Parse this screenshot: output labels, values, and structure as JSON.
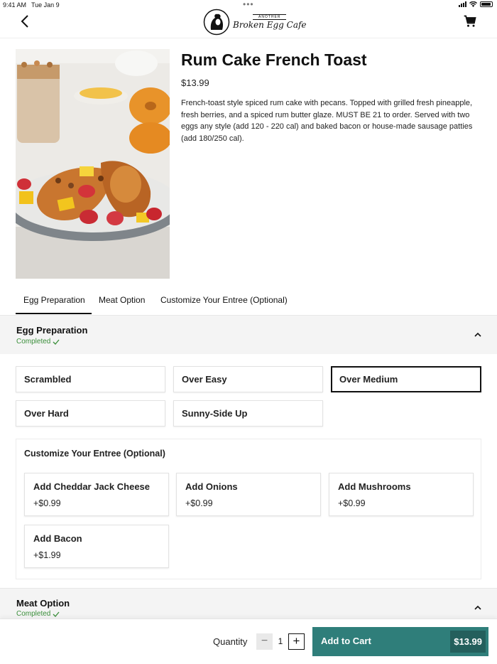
{
  "status_bar": {
    "time": "9:41 AM",
    "date": "Tue Jan 9",
    "dots": "•••"
  },
  "header": {
    "logo_top": "ANOTHER",
    "logo_main": "Broken Egg Cafe"
  },
  "product": {
    "title": "Rum Cake French Toast",
    "price": "$13.99",
    "description": "French-toast style spiced rum cake with pecans. Topped with grilled fresh pineapple, fresh berries, and a spiced rum butter glaze. MUST BE 21 to order. Served with two eggs any style (add 120 - 220 cal) and baked bacon or house-made sausage patties (add 180/250 cal)."
  },
  "tabs": [
    {
      "label": "Egg Preparation",
      "active": true
    },
    {
      "label": "Meat Option",
      "active": false
    },
    {
      "label": "Customize Your Entree (Optional)",
      "active": false
    }
  ],
  "egg_section": {
    "title": "Egg Preparation",
    "status": "Completed",
    "options": [
      {
        "label": "Scrambled",
        "selected": false
      },
      {
        "label": "Over Easy",
        "selected": false
      },
      {
        "label": "Over Medium",
        "selected": true
      },
      {
        "label": "Over Hard",
        "selected": false
      },
      {
        "label": "Sunny-Side Up",
        "selected": false
      }
    ]
  },
  "customize": {
    "title": "Customize Your Entree (Optional)",
    "addons": [
      {
        "name": "Add Cheddar Jack Cheese",
        "price": "+$0.99"
      },
      {
        "name": "Add Onions",
        "price": "+$0.99"
      },
      {
        "name": "Add Mushrooms",
        "price": "+$0.99"
      },
      {
        "name": "Add Bacon",
        "price": "+$1.99"
      }
    ]
  },
  "meat_section": {
    "title": "Meat Option",
    "status": "Completed"
  },
  "footer": {
    "quantity_label": "Quantity",
    "quantity": "1",
    "minus": "−",
    "plus": "+",
    "add_to_cart": "Add to Cart",
    "total": "$13.99"
  },
  "colors": {
    "accent": "#2f7e7a",
    "completed": "#3b8f3b"
  }
}
